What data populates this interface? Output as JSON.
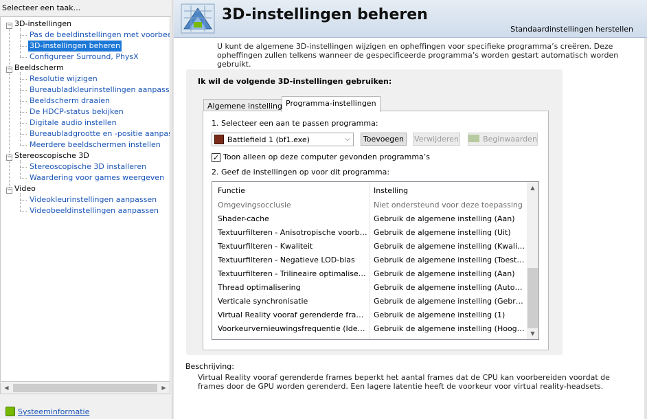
{
  "left_panel": {
    "header": "Selecteer een taak...",
    "tree": [
      {
        "category": "3D-instellingen",
        "items": [
          {
            "label": "Pas de beeldinstellingen met voorbeeld aan",
            "selected": false
          },
          {
            "label": "3D-instellingen beheren",
            "selected": true
          },
          {
            "label": "Configureer Surround, PhysX",
            "selected": false
          }
        ]
      },
      {
        "category": "Beeldscherm",
        "items": [
          {
            "label": "Resolutie wijzigen"
          },
          {
            "label": "Bureaubladkleurinstellingen aanpassen"
          },
          {
            "label": "Beeldscherm draaien"
          },
          {
            "label": "De HDCP-status bekijken"
          },
          {
            "label": "Digitale audio instellen"
          },
          {
            "label": "Bureaubladgrootte en -positie aanpassen"
          },
          {
            "label": "Meerdere beeldschermen instellen"
          }
        ]
      },
      {
        "category": "Stereoscopische 3D",
        "items": [
          {
            "label": "Stereoscopische 3D installeren"
          },
          {
            "label": "Waardering voor games weergeven"
          }
        ]
      },
      {
        "category": "Video",
        "items": [
          {
            "label": "Videokleurinstellingen aanpassen"
          },
          {
            "label": "Videobeeldinstellingen aanpassen"
          }
        ]
      }
    ],
    "system_info_link": "Systeeminformatie",
    "collapse_glyph": "−"
  },
  "header": {
    "title": "3D-instellingen beheren",
    "restore_defaults": "Standaardinstellingen herstellen"
  },
  "intro": "U kunt de algemene 3D-instellingen wijzigen en opheffingen voor specifieke programma’s creëren. Deze opheffingen zullen telkens wanneer de gespecificeerde programma’s worden gestart automatisch worden gebruikt.",
  "group": {
    "title": "Ik wil de volgende 3D-instellingen gebruiken:",
    "tabs": [
      {
        "label": "Algemene instellingen",
        "active": false
      },
      {
        "label": "Programma-instellingen",
        "active": true
      }
    ],
    "step1": "1. Selecteer een aan te passen programma:",
    "program_selected": "Battlefield 1 (bf1.exe)",
    "add_button": "Toevoegen",
    "remove_button": "Verwijderen",
    "restore_button": "Beginwaarden",
    "checkbox_label": "Toon alleen op deze computer gevonden programma’s",
    "checkbox_checked": true,
    "step2": "2. Geef de instellingen op voor dit programma:",
    "columns": [
      "Functie",
      "Instelling"
    ],
    "rows": [
      {
        "feature": "Omgevingsocclusie",
        "setting": "Niet ondersteund voor deze toepassing",
        "disabled": true
      },
      {
        "feature": "Shader-cache",
        "setting": "Gebruik de algemene instelling (Aan)"
      },
      {
        "feature": "Textuurfilteren - Anisotropische voorbeeld...",
        "setting": "Gebruik de algemene instelling (Uit)"
      },
      {
        "feature": "Textuurfilteren - Kwaliteit",
        "setting": "Gebruik de algemene instelling (Kwaliteit)"
      },
      {
        "feature": "Textuurfilteren - Negatieve LOD-bias",
        "setting": "Gebruik de algemene instelling (Toestaan)"
      },
      {
        "feature": "Textuurfilteren - Trilineaire optimalisering",
        "setting": "Gebruik de algemene instelling (Aan)"
      },
      {
        "feature": "Thread optimalisering",
        "setting": "Gebruik de algemene instelling (Automatisch)"
      },
      {
        "feature": "Verticale synchronisatie",
        "setting": "Gebruik de algemene instelling (Gebruik de..."
      },
      {
        "feature": "Virtual Reality vooraf gerenderde frames",
        "setting": "Gebruik de algemene instelling (1)"
      },
      {
        "feature": "Voorkeurvernieuwingsfrequentie (Idek Iiy...",
        "setting": "Gebruik de algemene instelling (Hoogste b..."
      }
    ]
  },
  "description": {
    "title": "Beschrijving:",
    "text": "Virtual Reality vooraf gerenderde frames beperkt het aantal frames dat de CPU kan voorbereiden voordat de frames door de GPU worden gerenderd. Een lagere latentie heeft de voorkeur voor virtual reality-headsets."
  },
  "colors": {
    "link": "#1a55b8",
    "selection": "#1c78d7",
    "nvidia_green": "#76b900"
  }
}
